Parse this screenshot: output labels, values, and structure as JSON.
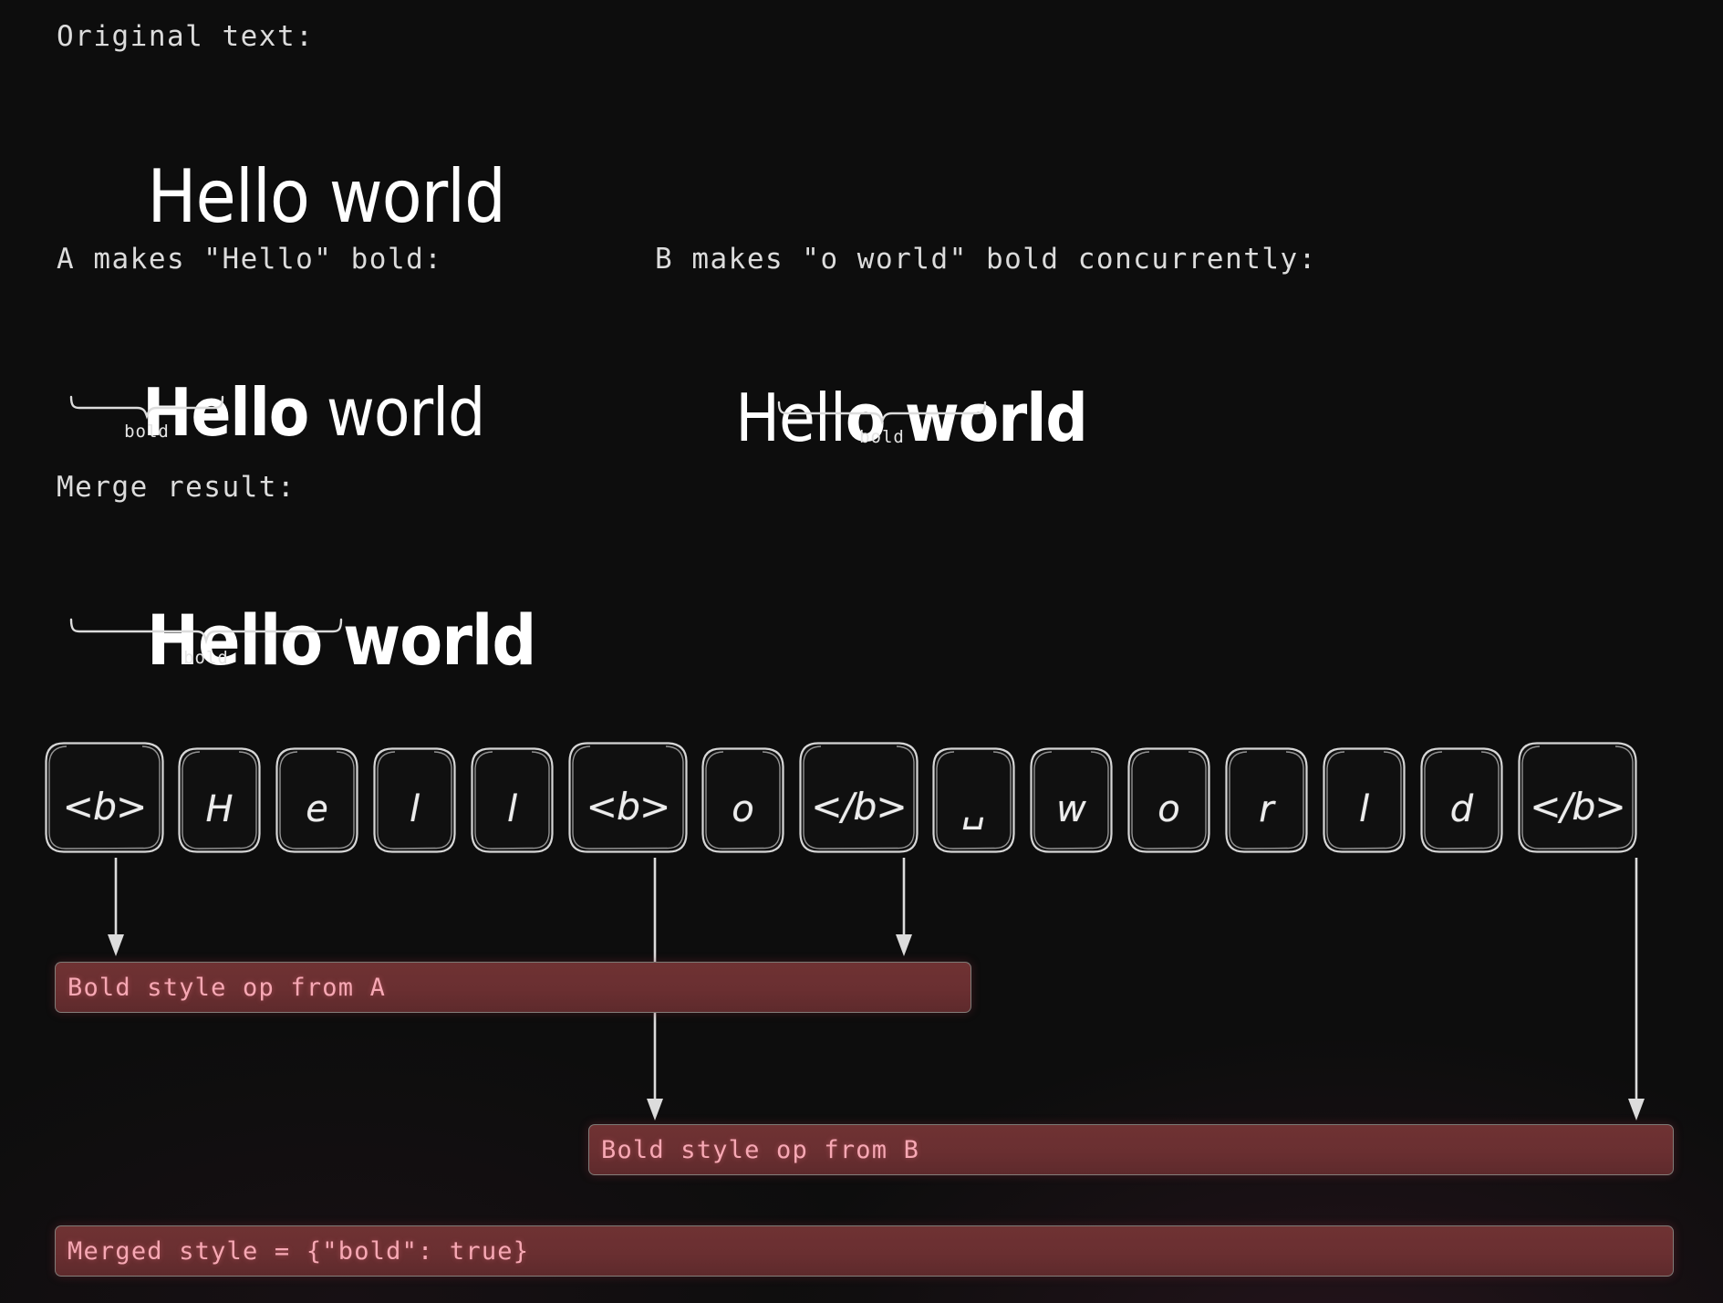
{
  "background_color": "#0d0d0d",
  "sections": {
    "original": {
      "caption": "Original text:",
      "text": "Hello world"
    },
    "a_edit": {
      "caption": "A makes \"Hello\" bold:",
      "bold_part": "Hello",
      "plain_part": " world",
      "brace_label": "bold"
    },
    "b_edit": {
      "caption": "B makes \"o world\" bold concurrently:",
      "plain_part": "Hell",
      "bold_part": "o world",
      "brace_label": "bold"
    },
    "merge": {
      "caption": "Merge result:",
      "bold_part": "Hello world",
      "brace_label": "bold"
    }
  },
  "tokens": [
    {
      "label": "<b>",
      "kind": "tag"
    },
    {
      "label": "H",
      "kind": "char"
    },
    {
      "label": "e",
      "kind": "char"
    },
    {
      "label": "l",
      "kind": "char"
    },
    {
      "label": "l",
      "kind": "char"
    },
    {
      "label": "<b>",
      "kind": "tag"
    },
    {
      "label": "o",
      "kind": "char"
    },
    {
      "label": "</b>",
      "kind": "tag"
    },
    {
      "label": "␣",
      "kind": "space"
    },
    {
      "label": "w",
      "kind": "char"
    },
    {
      "label": "o",
      "kind": "char"
    },
    {
      "label": "r",
      "kind": "char"
    },
    {
      "label": "l",
      "kind": "char"
    },
    {
      "label": "d",
      "kind": "char"
    },
    {
      "label": "</b>",
      "kind": "tag"
    }
  ],
  "annotations": [
    {
      "text": "Bold style op from A",
      "accent": "#f7a8b4",
      "fill": "#6a2f31"
    },
    {
      "text": "Bold style op from B",
      "accent": "#f7a8b4",
      "fill": "#6a2f31"
    },
    {
      "text": "Merged style = {\"bold\": true}",
      "accent": "#f7a8b4",
      "fill": "#6a2f31"
    }
  ]
}
